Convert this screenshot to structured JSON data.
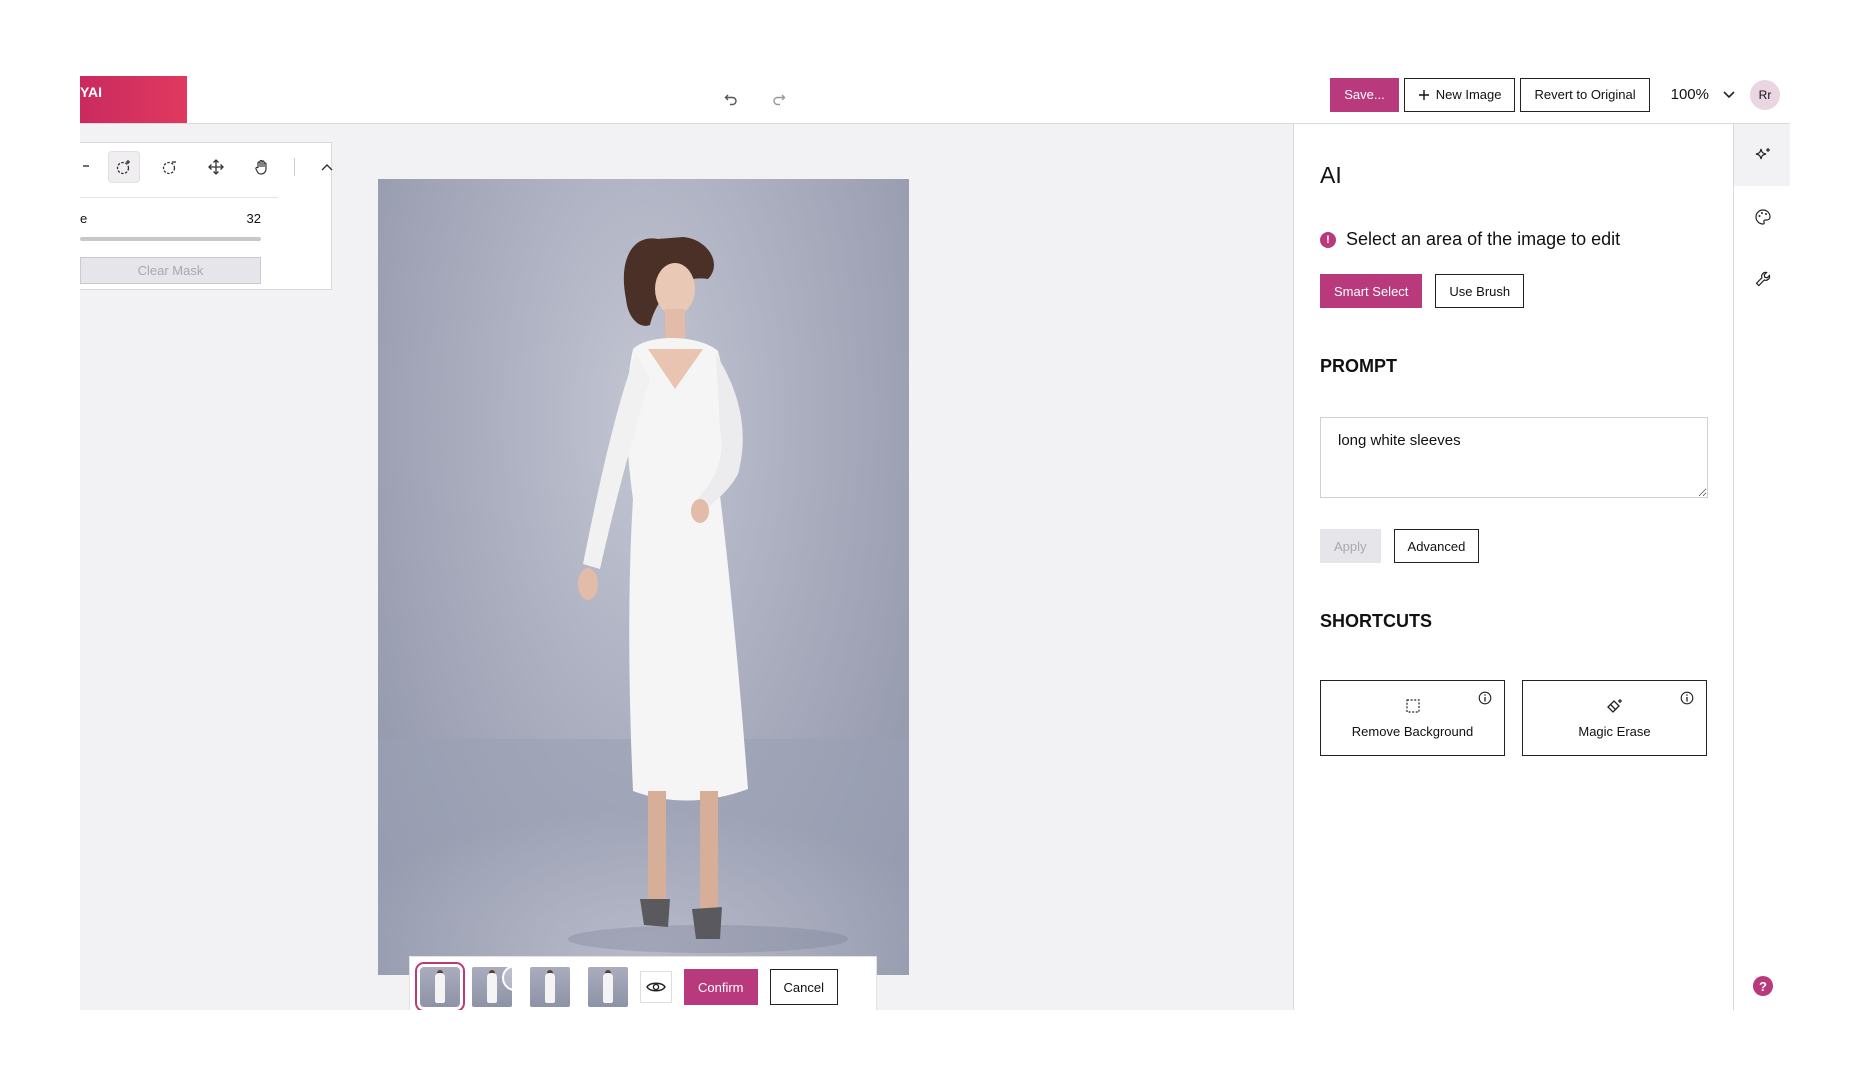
{
  "header": {
    "logo_text": "YAI",
    "save_label": "Save...",
    "new_image_label": "New Image",
    "revert_label": "Revert to Original",
    "zoom": "100%",
    "avatar_initials": "Rr"
  },
  "tool_panel": {
    "size_label": "e",
    "size_value": "32",
    "clear_mask_label": "Clear Mask"
  },
  "variant_bar": {
    "confirm_label": "Confirm",
    "cancel_label": "Cancel"
  },
  "side_panel": {
    "title": "AI",
    "hint": "Select an area of the image to edit",
    "smart_select_label": "Smart Select",
    "use_brush_label": "Use Brush",
    "prompt_title": "PROMPT",
    "prompt_value": "long white sleeves",
    "apply_label": "Apply",
    "advanced_label": "Advanced",
    "shortcuts_title": "SHORTCUTS",
    "shortcuts": [
      {
        "label": "Remove Background",
        "icon": "dashed-square-icon"
      },
      {
        "label": "Magic Erase",
        "icon": "eraser-sparkle-icon"
      }
    ]
  },
  "rail": {
    "items": [
      "sparkles-icon",
      "palette-icon",
      "wrench-icon"
    ],
    "help_label": "?"
  },
  "colors": {
    "accent": "#b93a7c",
    "logo_gradient": "#d8345f"
  }
}
